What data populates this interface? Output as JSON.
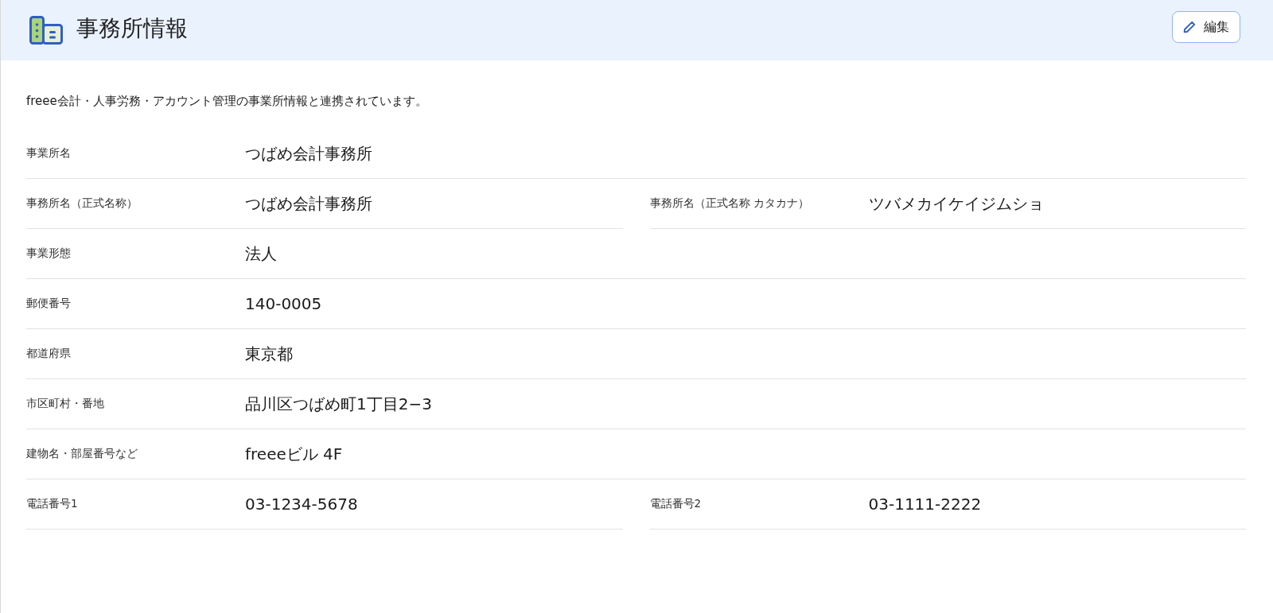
{
  "header": {
    "title": "事務所情報",
    "edit_button": {
      "label": "編集"
    }
  },
  "description": "freee会計・人事労務・アカウント管理の事業所情報と連携されています。",
  "rows": [
    {
      "fields": [
        {
          "label": "事業所名",
          "value": "つばめ会計事務所"
        }
      ]
    },
    {
      "fields": [
        {
          "label": "事務所名（正式名称）",
          "value": "つばめ会計事務所"
        },
        {
          "label": "事務所名（正式名称 カタカナ）",
          "value": "ツバメカイケイジムショ"
        }
      ]
    },
    {
      "fields": [
        {
          "label": "事業形態",
          "value": "法人"
        }
      ]
    },
    {
      "fields": [
        {
          "label": "郵便番号",
          "value": "140-0005"
        }
      ]
    },
    {
      "fields": [
        {
          "label": "都道府県",
          "value": "東京都"
        }
      ]
    },
    {
      "fields": [
        {
          "label": "市区町村・番地",
          "value": "品川区つばめ町1丁目2−3"
        }
      ]
    },
    {
      "fields": [
        {
          "label": "建物名・部屋番号など",
          "value": "freeeビル 4F"
        }
      ]
    },
    {
      "fields": [
        {
          "label": "電話番号1",
          "value": "03-1234-5678"
        },
        {
          "label": "電話番号2",
          "value": "03-1111-2222"
        }
      ]
    }
  ]
}
